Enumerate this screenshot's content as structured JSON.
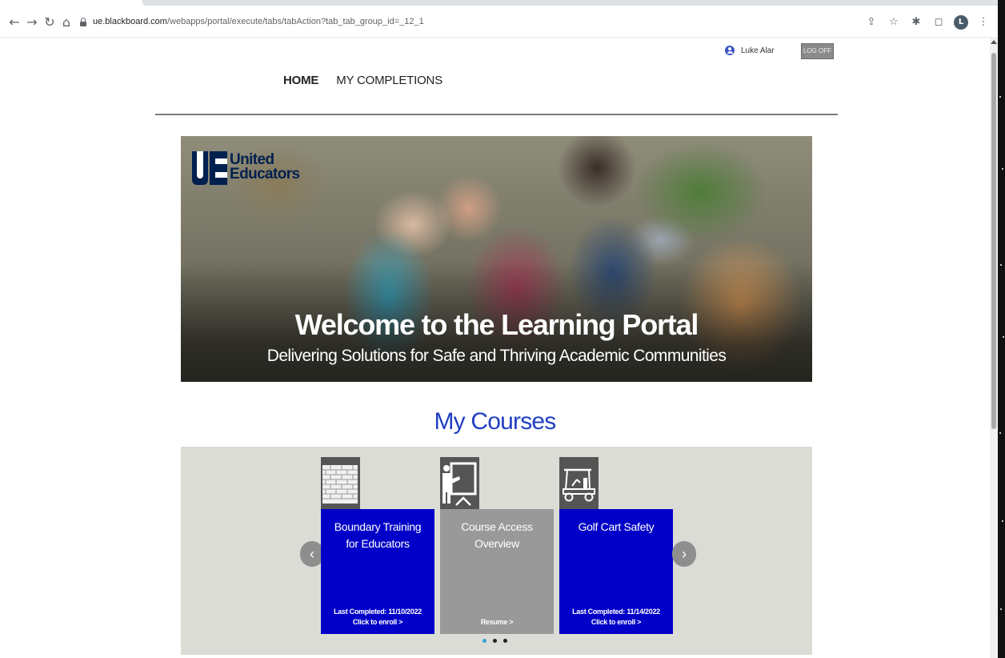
{
  "browser": {
    "url_host": "ue.blackboard.com",
    "url_path": "/webapps/portal/execute/tabs/tabAction?tab_tab_group_id=_12_1",
    "profile_initial": "L"
  },
  "header": {
    "user_name": "Luke Alar",
    "logoff_label": "LOG OFF",
    "nav": [
      {
        "label": "HOME"
      },
      {
        "label": "MY COMPLETIONS"
      }
    ]
  },
  "hero": {
    "logo_line1": "United",
    "logo_line2": "Educators",
    "title": "Welcome to the Learning Portal",
    "subtitle": "Delivering Solutions for Safe and Thriving Academic Communities"
  },
  "courses": {
    "heading": "My Courses",
    "items": [
      {
        "title": "Boundary Training for Educators",
        "meta": "Last Completed: 11/10/2022",
        "action": "Click to enroll >",
        "color": "#0000c8",
        "icon": "brick-wall-icon"
      },
      {
        "title": "Course Access Overview",
        "meta": "",
        "action": "Resume >",
        "color": "#999999",
        "icon": "presenter-board-icon"
      },
      {
        "title": "Golf Cart Safety",
        "meta": "Last Completed: 11/14/2022",
        "action": "Click to enroll >",
        "color": "#0000c8",
        "icon": "golf-cart-icon"
      }
    ],
    "prev_icon": "chevron-left-icon",
    "next_icon": "chevron-right-icon",
    "page_count": 3,
    "active_page": 1
  },
  "colors": {
    "heading_blue": "#1f3fc1",
    "card_blue": "#0000c8",
    "card_gray": "#999999",
    "logo_navy": "#00204f"
  }
}
